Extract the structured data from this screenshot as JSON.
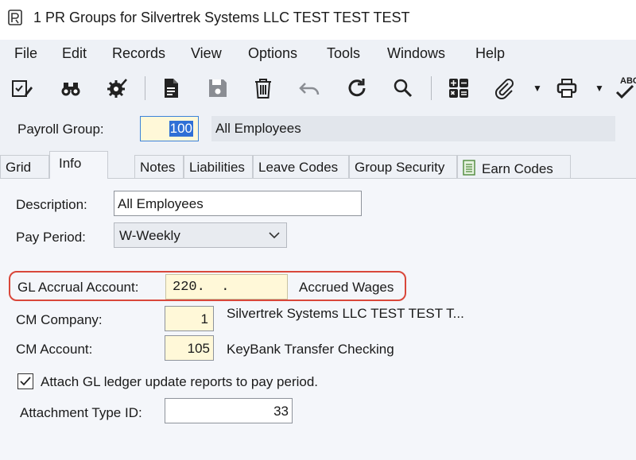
{
  "window": {
    "title": "1 PR Groups for Silvertrek Systems LLC TEST TEST TEST"
  },
  "menu": [
    "File",
    "Edit",
    "Records",
    "View",
    "Options",
    "Tools",
    "Windows",
    "Help"
  ],
  "toolbar": {
    "icons": [
      "checklist-edit-icon",
      "binoculars-icon",
      "gear-check-icon",
      "document-icon",
      "save-icon",
      "trash-icon",
      "undo-icon",
      "refresh-icon",
      "search-icon",
      "calculator-icon",
      "paperclip-icon",
      "printer-icon",
      "spellcheck-icon"
    ],
    "spell_label": "ABC"
  },
  "header": {
    "payroll_group_label": "Payroll Group:",
    "payroll_group_value": "100",
    "payroll_group_desc": "All Employees"
  },
  "tabs": [
    {
      "label": "Grid",
      "active": false
    },
    {
      "label": "Info",
      "active": true
    },
    {
      "label": "Notes",
      "active": false
    },
    {
      "label": "Liabilities",
      "active": false
    },
    {
      "label": "Leave Codes",
      "active": false
    },
    {
      "label": "Group Security",
      "active": false
    },
    {
      "label": "Earn Codes",
      "active": false
    }
  ],
  "form": {
    "description_label": "Description:",
    "description_value": "All Employees",
    "pay_period_label": "Pay Period:",
    "pay_period_value": "W-Weekly",
    "gl_accrual_label": "GL Accrual Account:",
    "gl_accrual_value": "220.  .",
    "gl_accrual_desc": "Accrued Wages",
    "cm_company_label": "CM Company:",
    "cm_company_value": "1",
    "cm_company_desc": "Silvertrek Systems LLC TEST TEST T...",
    "cm_account_label": "CM Account:",
    "cm_account_value": "105",
    "cm_account_desc": "KeyBank Transfer Checking",
    "attach_label": "Attach GL ledger update reports to pay period.",
    "attach_checked": true,
    "attachment_type_label": "Attachment Type ID:",
    "attachment_type_value": "33"
  },
  "colors": {
    "highlight": "#d9473a",
    "required_field": "#fff8d8",
    "selection": "#2f6fd6"
  }
}
